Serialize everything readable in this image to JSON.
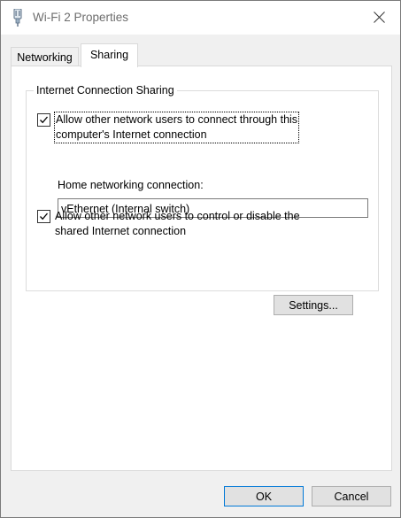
{
  "window": {
    "title": "Wi-Fi 2 Properties",
    "icon": "network-adapter-icon",
    "close_icon": "close-icon"
  },
  "tabs": [
    {
      "label": "Networking",
      "active": false
    },
    {
      "label": "Sharing",
      "active": true
    }
  ],
  "sharing": {
    "group_title": "Internet Connection Sharing",
    "allow_connect": {
      "line1": "Allow other network users to connect through this",
      "line2": "computer's Internet connection",
      "checked": true
    },
    "home_connection_label": "Home networking connection:",
    "home_connection_value": "vEthernet (Internal switch)",
    "allow_control": {
      "line1": "Allow other network users to control or disable the",
      "line2": "shared Internet connection",
      "checked": true
    },
    "settings_button": "Settings..."
  },
  "footer": {
    "ok_label": "OK",
    "cancel_label": "Cancel"
  }
}
